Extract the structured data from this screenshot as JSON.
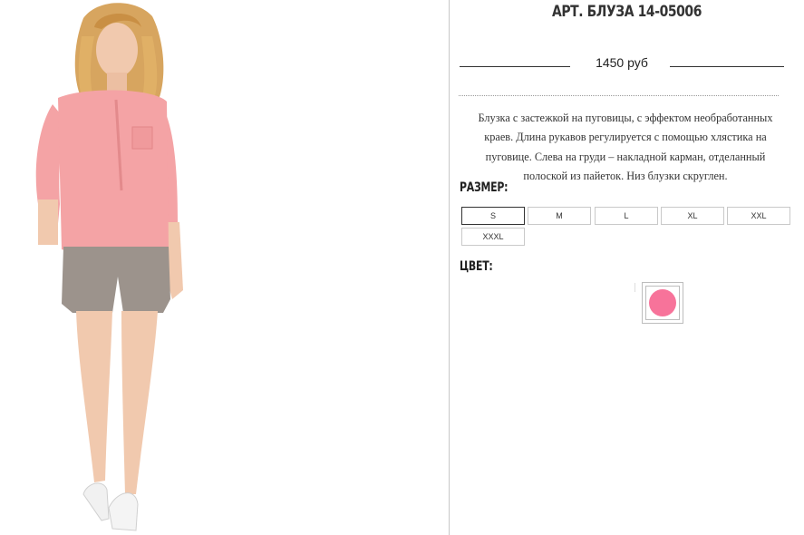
{
  "product": {
    "title": "АРТ. БЛУЗА 14-05006",
    "price": "1450 руб",
    "description": [
      "Блузка с застежкой на пуговицы, с эффектом необработанных",
      "краев. Длина рукавов регулируется с помощью хлястика на",
      "пуговице. Слева на груди – накладной карман, отделанный",
      "полоской из пайеток. Низ блузки скруглен."
    ]
  },
  "size_section": {
    "label": "РАЗМЕР:",
    "selected": "S",
    "options": [
      "S",
      "M",
      "L",
      "XL",
      "XXL",
      "XXXL"
    ]
  },
  "color_section": {
    "label": "ЦВЕТ:",
    "swatches": [
      {
        "name": "pink",
        "hex": "#f7739a"
      }
    ]
  },
  "colors": {
    "blouse": "#f4a3a5",
    "shorts": "#9c938c",
    "skin": "#f1c9ae",
    "hair": "#d7a55f"
  }
}
